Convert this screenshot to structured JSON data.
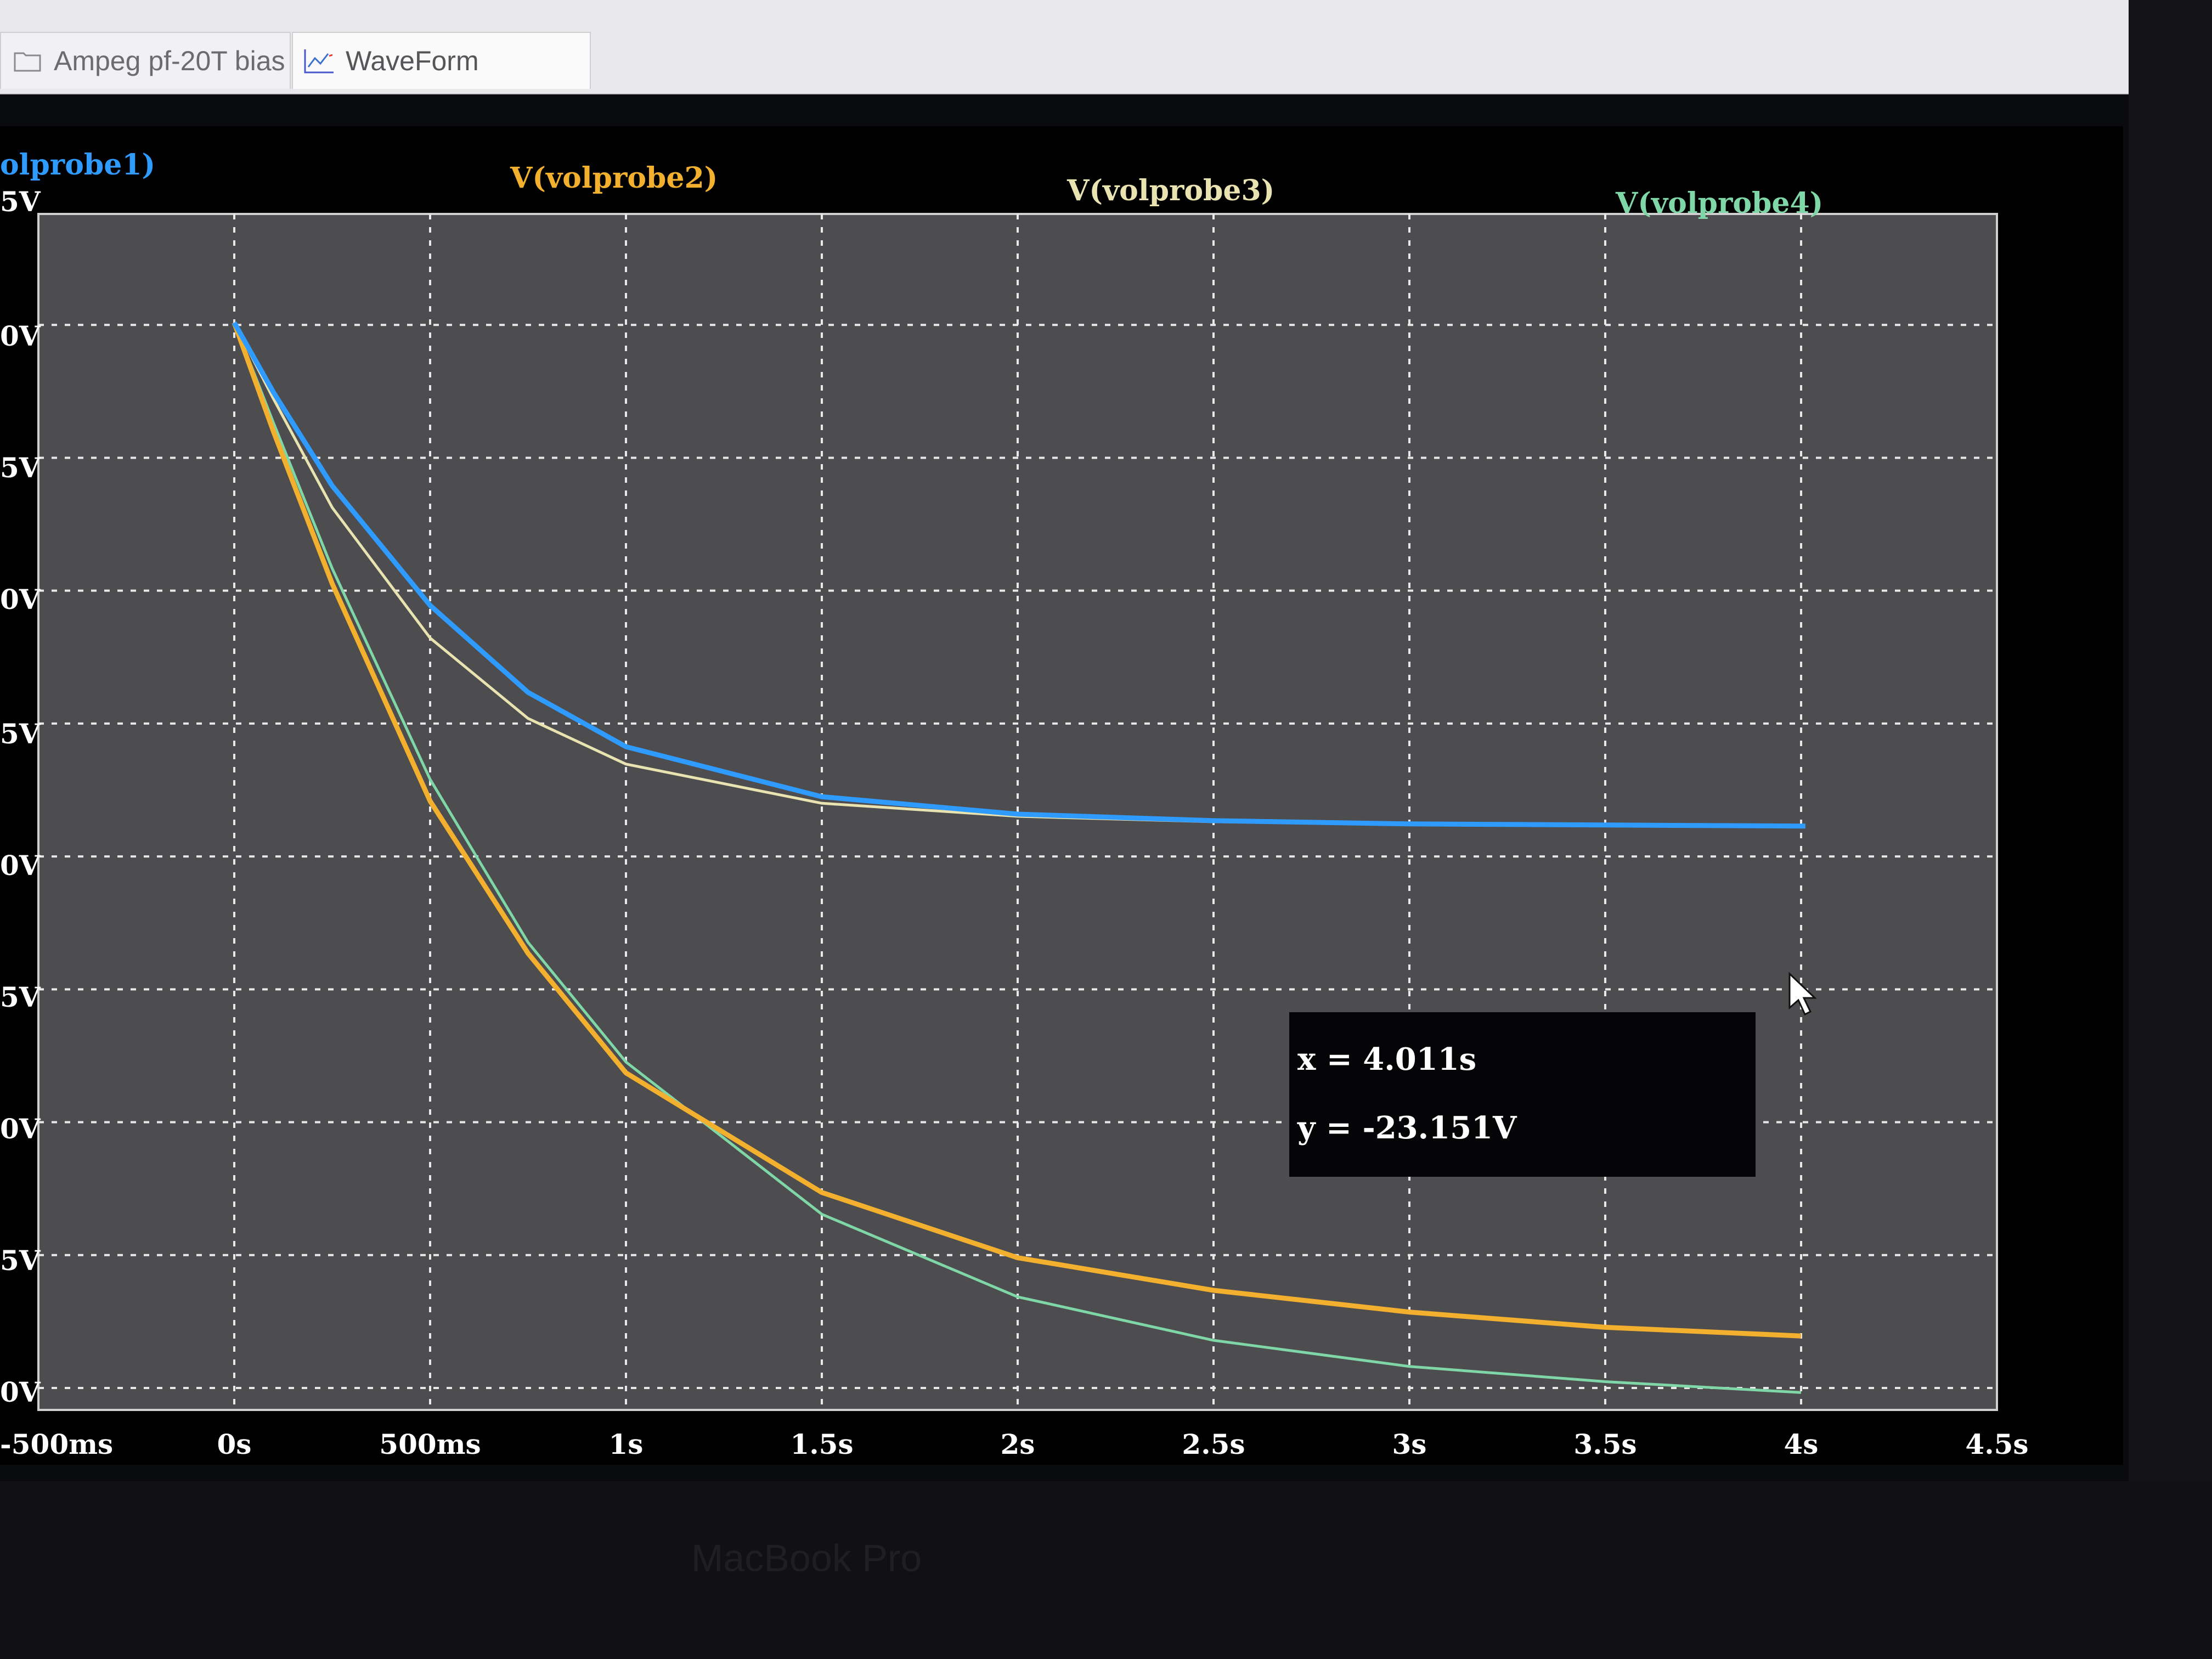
{
  "tabs": [
    {
      "label": "Ampeg pf-20T bias",
      "icon": "folder-icon",
      "active": false
    },
    {
      "label": "WaveForm",
      "icon": "waveform-chart-icon",
      "active": true
    }
  ],
  "brand": "MacBook Pro",
  "colors": {
    "probe1": "#2f9bff",
    "probe2": "#f2b02e",
    "probe3": "#e8e3b0",
    "probe4": "#7fd6a6",
    "grid": "#e8e8e8",
    "plot_bg": "#4d4d4f"
  },
  "tooltip": {
    "x_text": "x = 4.011s",
    "y_text": "y = -23.151V"
  },
  "chart_data": {
    "type": "line",
    "legend": [
      "olprobe1)",
      "V(volprobe2)",
      "V(volprobe3)",
      "V(volprobe4)"
    ],
    "x_ticks": [
      "-500ms",
      "0s",
      "500ms",
      "1s",
      "1.5s",
      "2s",
      "2.5s",
      "3s",
      "3.5s",
      "4s",
      "4.5s"
    ],
    "y_ticks": [
      "5V",
      "0V",
      "5V",
      "0V",
      "5V",
      "0V",
      "5V",
      "0V",
      "5V",
      "0V"
    ],
    "xlim": [
      -0.5,
      4.5
    ],
    "series": [
      {
        "name": "olprobe1)",
        "x": [
          0,
          0.1,
          0.25,
          0.5,
          0.75,
          1,
          1.5,
          2,
          2.5,
          3,
          3.5,
          4,
          4.011
        ],
        "y": [
          0,
          -3.2,
          -7.5,
          -13,
          -17,
          -19.5,
          -21.8,
          -22.6,
          -22.9,
          -23.05,
          -23.1,
          -23.15,
          -23.151
        ]
      },
      {
        "name": "V(volprobe2)",
        "x": [
          0,
          0.1,
          0.25,
          0.5,
          0.75,
          1,
          1.5,
          2,
          2.5,
          3,
          3.5,
          4
        ],
        "y": [
          0,
          -5,
          -12,
          -22,
          -29,
          -34.5,
          -40,
          -43,
          -44.5,
          -45.5,
          -46.2,
          -46.6
        ]
      },
      {
        "name": "V(volprobe3)",
        "x": [
          0,
          0.1,
          0.25,
          0.5,
          0.75,
          1,
          1.5,
          2,
          2.5,
          3,
          3.5,
          4
        ],
        "y": [
          0,
          -3.5,
          -8.5,
          -14.5,
          -18.2,
          -20.3,
          -22.1,
          -22.7,
          -22.95,
          -23.05,
          -23.1,
          -23.15
        ]
      },
      {
        "name": "V(volprobe4)",
        "x": [
          0,
          0.1,
          0.25,
          0.5,
          0.75,
          1,
          1.5,
          2,
          2.5,
          3,
          3.5,
          4
        ],
        "y": [
          0,
          -4.6,
          -11.3,
          -21,
          -28.5,
          -34,
          -41,
          -44.8,
          -46.8,
          -48,
          -48.7,
          -49.2
        ]
      }
    ],
    "ylim": [
      -50,
      5
    ],
    "grid": true
  }
}
